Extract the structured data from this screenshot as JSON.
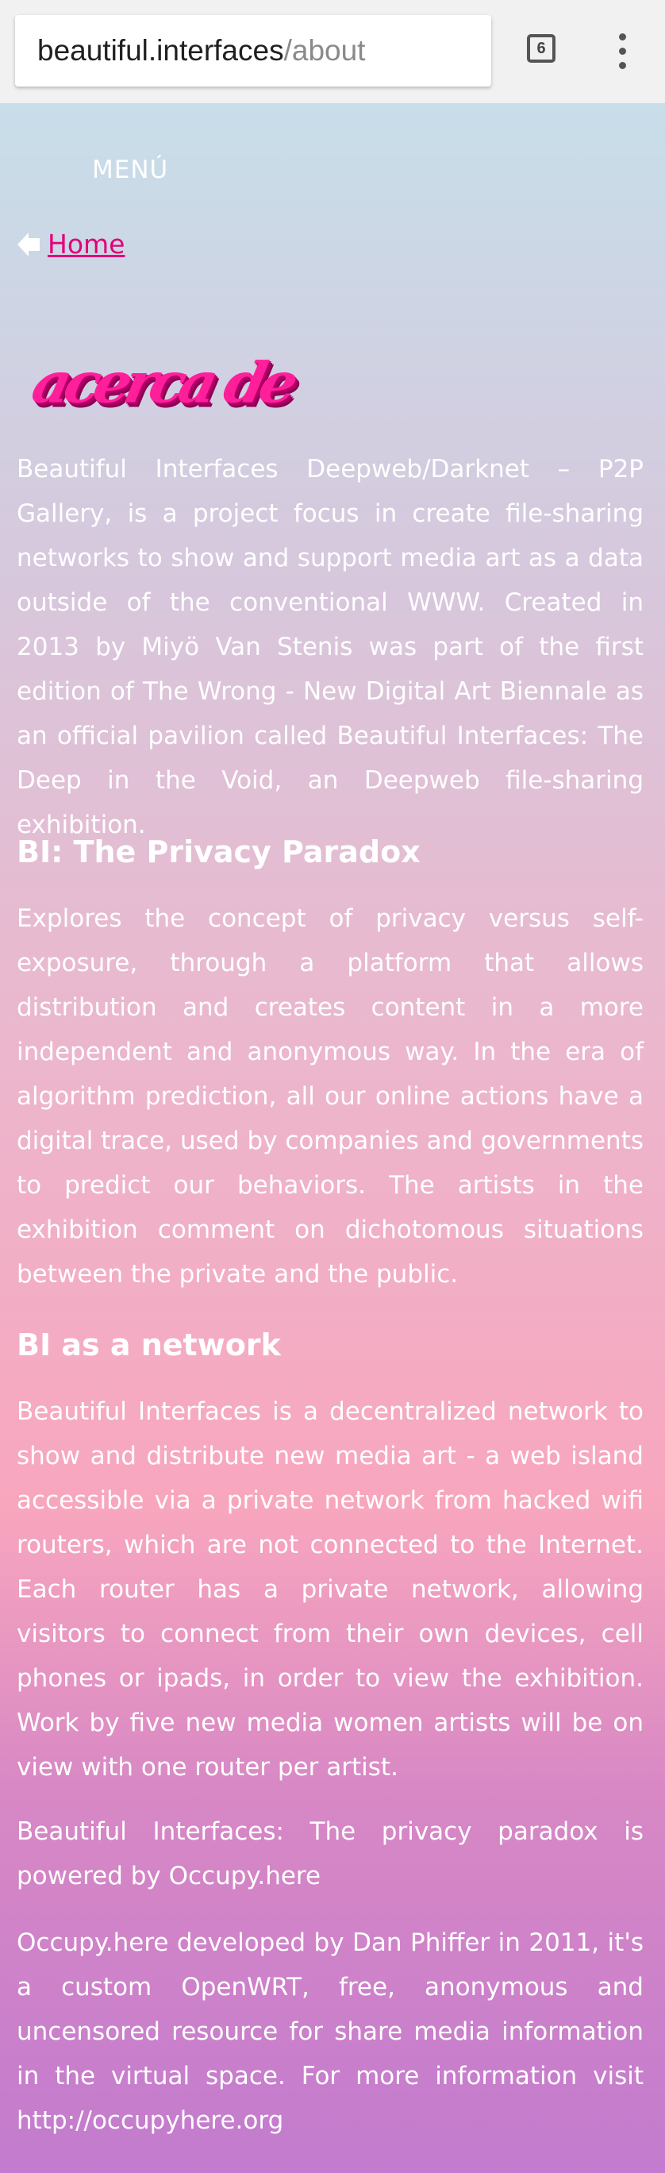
{
  "browser": {
    "url_host": "beautiful.interfaces",
    "url_path": "/about",
    "tab_count": "6"
  },
  "nav": {
    "menu_label": "MENÚ",
    "breadcrumb_home": "Home"
  },
  "logo_text": "acerca de",
  "sections": {
    "intro": "Beautiful Interfaces Deepweb/Darknet – P2P Gallery, is a project focus in create file-sharing networks to show and support media art as a data outside of the conventional WWW. Created in 2013 by Miyö Van Stenis was part of the first edition of The Wrong - New Digital Art Biennale as an official pavilion called Beautiful Interfaces: The Deep in the Void, an Deepweb file-sharing exhibition.",
    "privacy_heading": "BI: The Privacy Paradox",
    "privacy_text": "Explores the concept of privacy versus self-exposure, through a platform that allows distribution and creates content in a more independent and anonymous way. In the era of algorithm prediction, all our online actions have a digital trace, used by companies and governments to predict our behaviors. The artists in the exhibition comment on dichotomous situations between the private and the public.",
    "network_heading": "BI as a network",
    "network_text": "Beautiful Interfaces is a decentralized network to show and distribute new media art - a web island accessible via a private network from hacked wifi routers, which are not connected to the Internet. Each router has a private network, allowing visitors to connect from their own devices, cell phones or ipads, in order to view the exhibition. Work by five new media women artists will be on view with one router per artist.",
    "powered_text": "Beautiful Interfaces: The privacy paradox is powered by Occupy.here",
    "occupy_text": "Occupy.here developed by Dan Phiffer in 2011, it's a custom OpenWRT, free, anonymous and uncensored resource for share media information in the virtual space. For more information visit http://occupyhere.org"
  },
  "colors": {
    "link": "#e0007a",
    "logo": "#ff1f9a",
    "text": "#ffffff"
  },
  "icons": [
    "tabs-icon",
    "overflow-menu-icon",
    "home-arrow-icon"
  ]
}
